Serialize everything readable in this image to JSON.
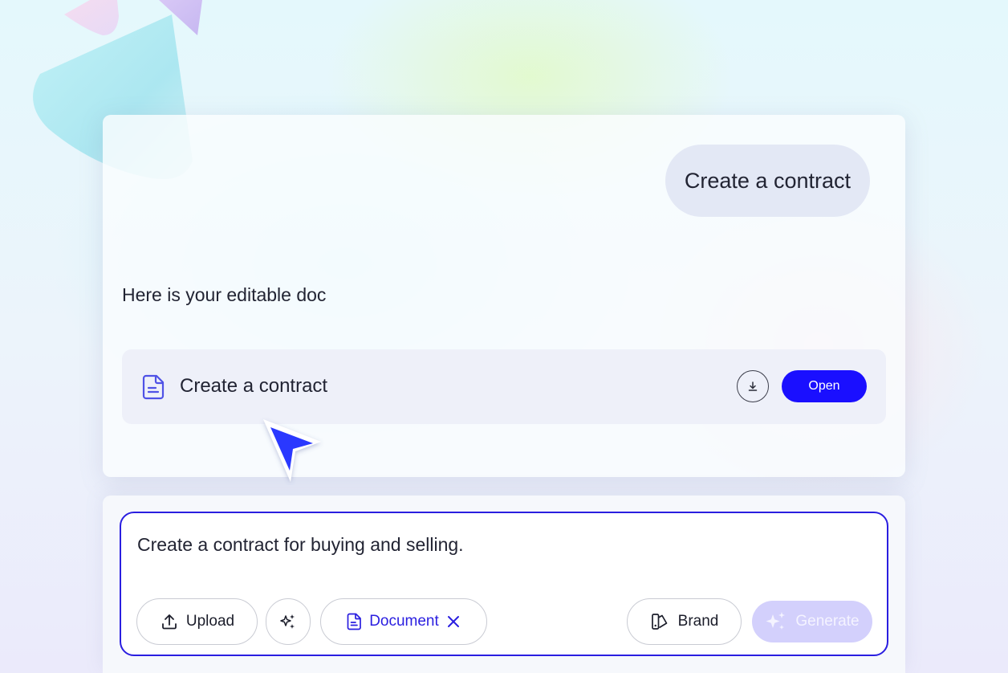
{
  "chat": {
    "user_message": "Create a contract",
    "assistant_message": "Here is your editable doc",
    "document": {
      "title": "Create a contract",
      "icon": "document-icon",
      "download_icon": "download-icon",
      "open_label": "Open"
    }
  },
  "composer": {
    "prompt": "Create a contract for buying and selling.",
    "upload_label": "Upload",
    "upload_icon": "upload-icon",
    "magic_icon": "sparkle-icon",
    "document_chip_label": "Document",
    "document_chip_icon": "document-icon",
    "document_chip_close_icon": "close-icon",
    "brand_label": "Brand",
    "brand_icon": "brand-icon",
    "generate_label": "Generate",
    "generate_icon": "sparkle-icon"
  },
  "colors": {
    "accent": "#1a0fff",
    "composer_border": "#2a1ee0",
    "generate_disabled": "#d3d0fc",
    "user_bubble": "#e3e8f5",
    "doc_card": "#eef0f9"
  }
}
